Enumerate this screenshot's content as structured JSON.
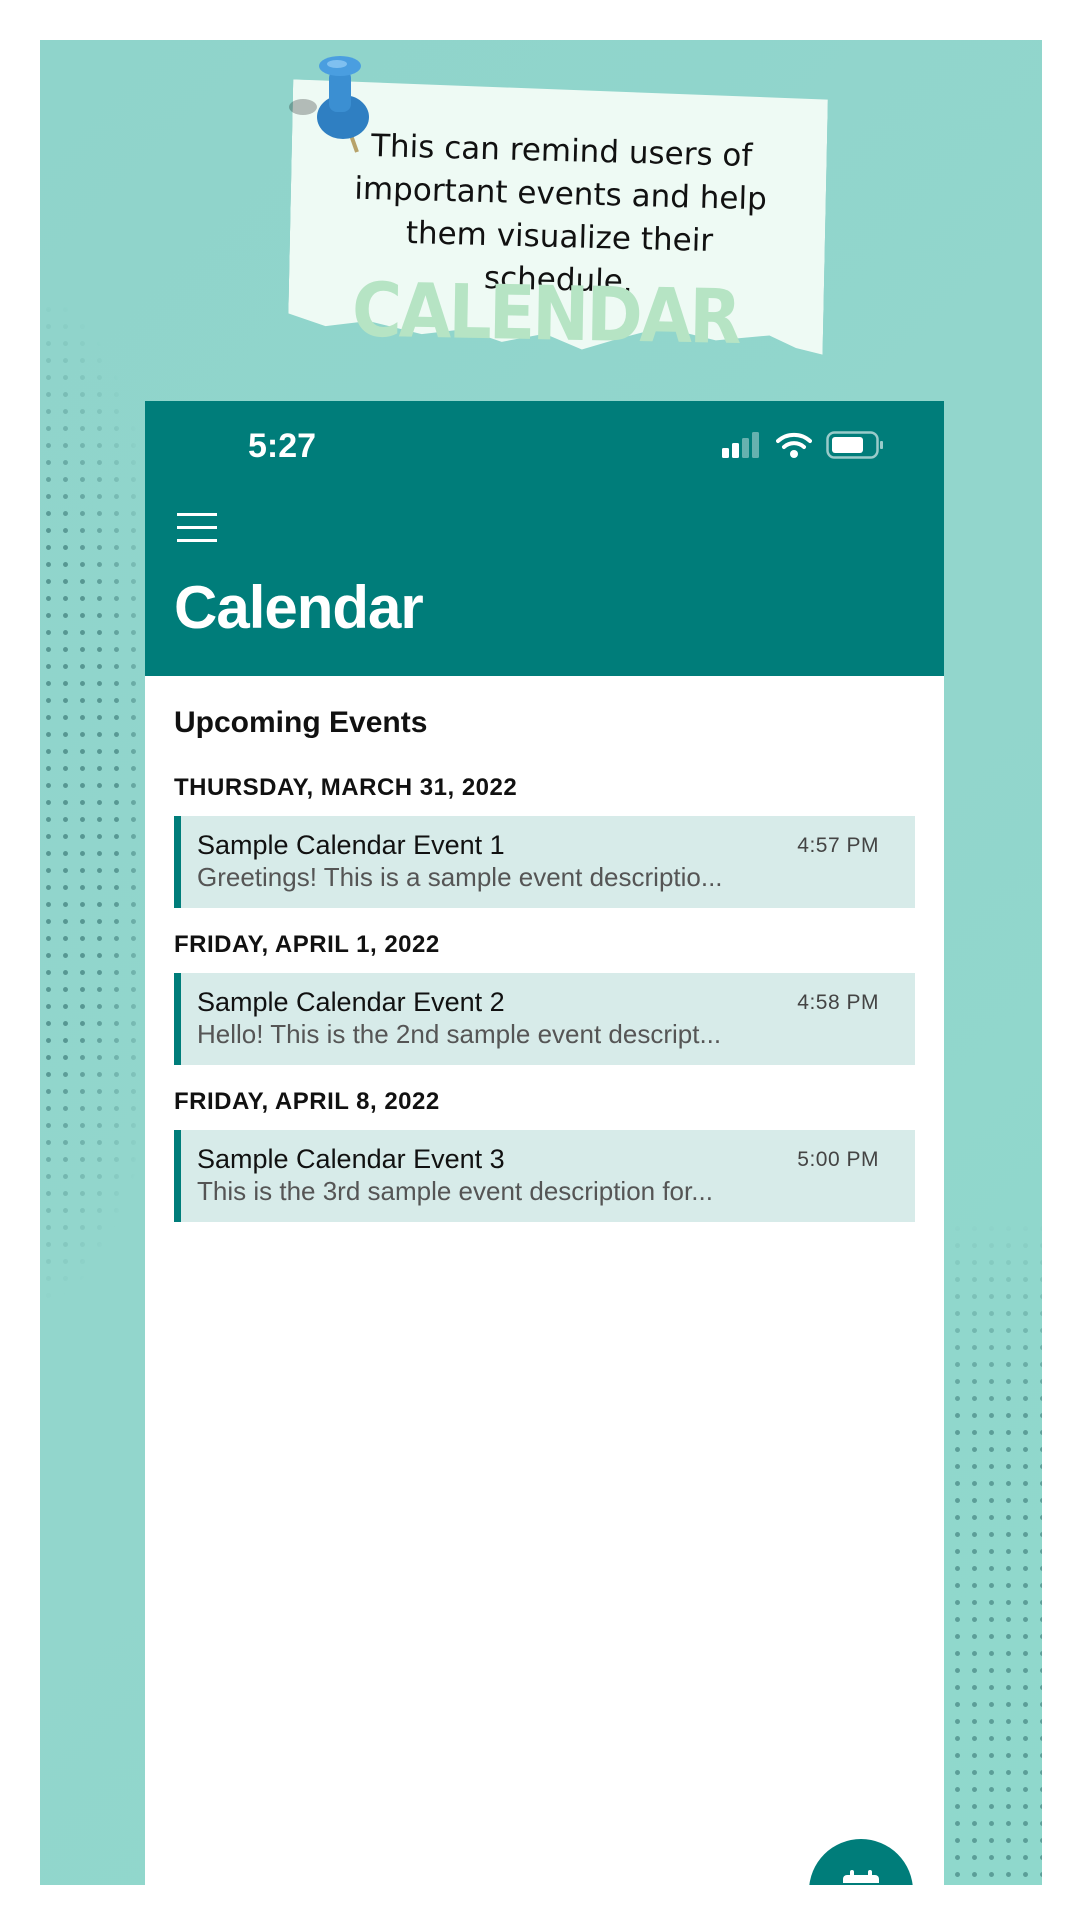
{
  "note": {
    "text": "This can remind users of important events and help them visualize their schedule.",
    "word": "CALENDAR"
  },
  "status_bar": {
    "time": "5:27"
  },
  "app_bar": {
    "title": "Calendar",
    "menu_icon": "hamburger-menu-icon"
  },
  "section_title": "Upcoming Events",
  "days": [
    {
      "header": "THURSDAY, MARCH 31, 2022",
      "events": [
        {
          "title": "Sample Calendar Event 1",
          "description": "Greetings! This is a sample event descriptio...",
          "time": "4:57 PM"
        }
      ]
    },
    {
      "header": "FRIDAY, APRIL 1, 2022",
      "events": [
        {
          "title": "Sample Calendar Event 2",
          "description": "Hello! This is the 2nd sample event descript...",
          "time": "4:58 PM"
        }
      ]
    },
    {
      "header": "FRIDAY, APRIL 8, 2022",
      "events": [
        {
          "title": "Sample Calendar Event 3",
          "description": "This is the 3rd sample event description for...",
          "time": "5:00 PM"
        }
      ]
    }
  ],
  "fab": {
    "icon": "calendar-add-icon"
  },
  "colors": {
    "primary": "#007d7a",
    "event_bg": "#d7ebe9",
    "background": "#8fd4cb",
    "note_bg": "#eefaf4"
  }
}
